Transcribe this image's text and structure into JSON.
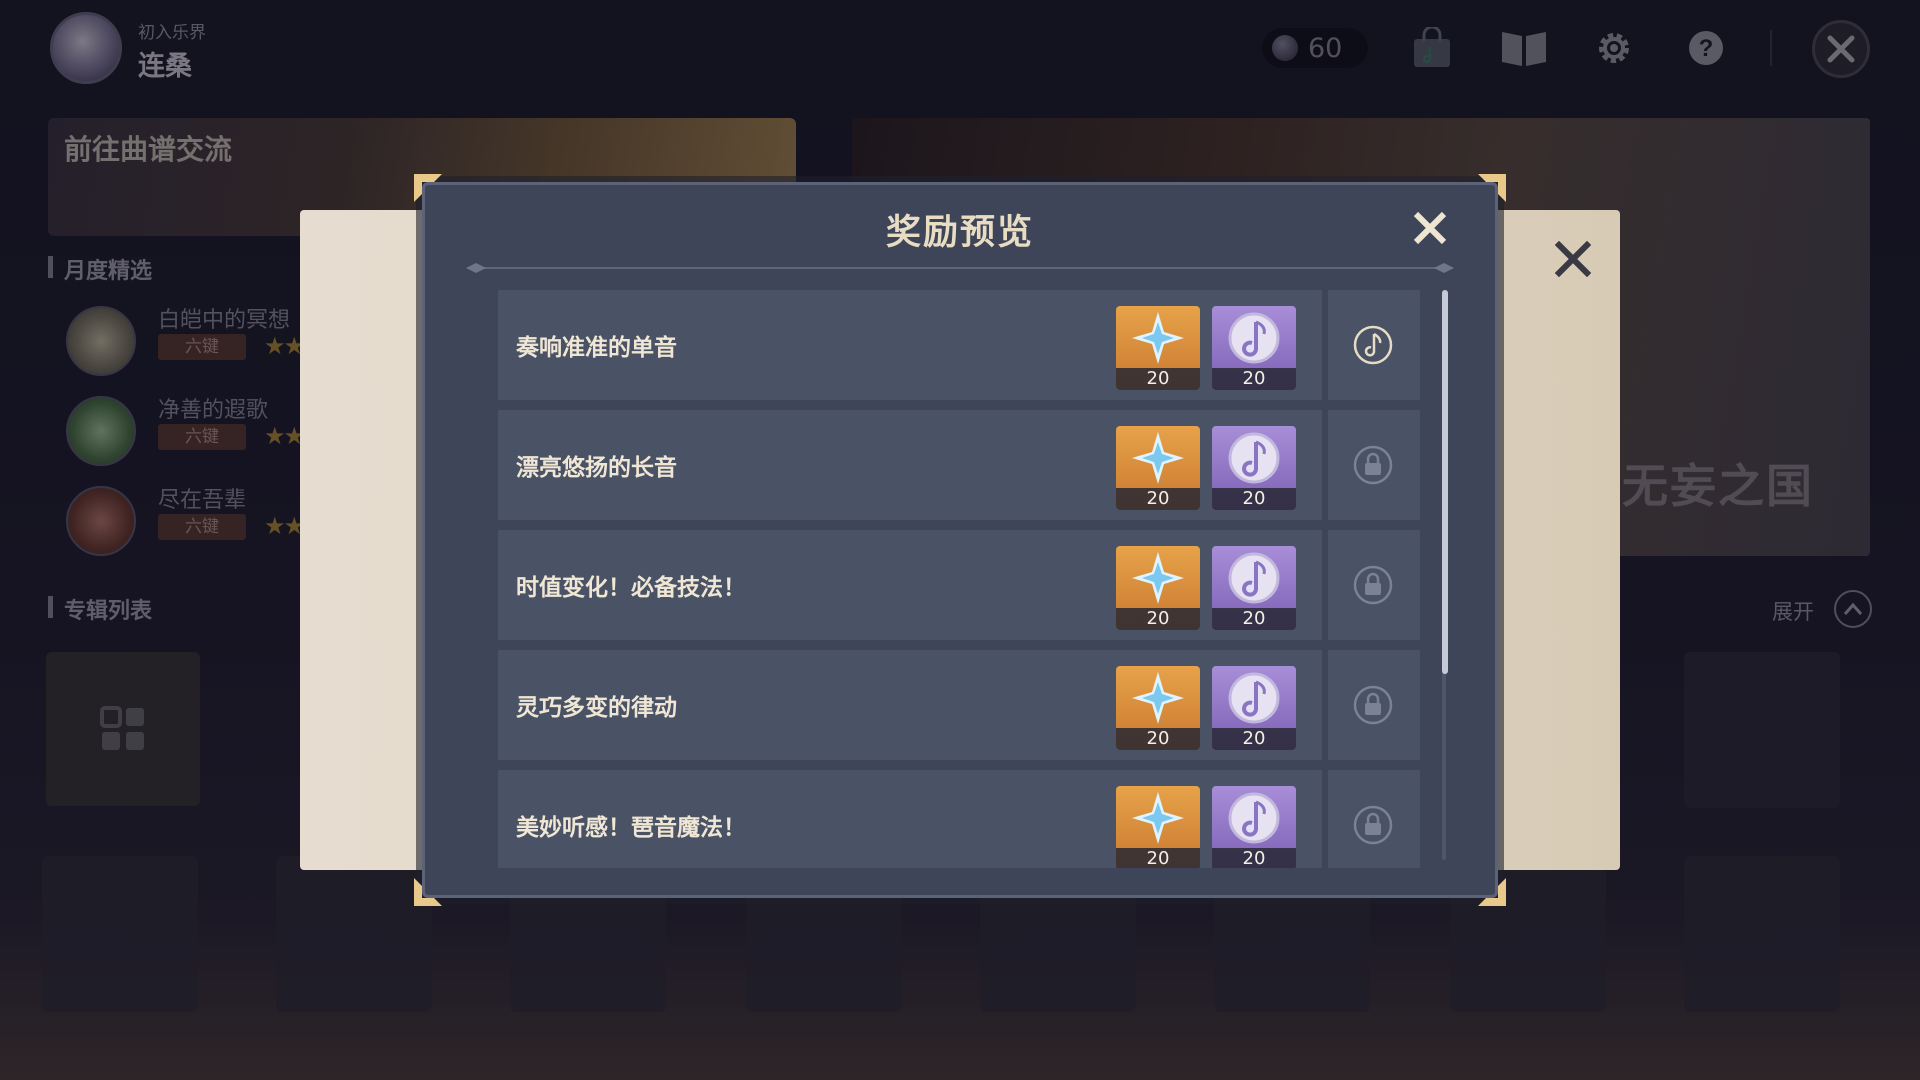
{
  "player": {
    "subtitle": "初入乐界",
    "name": "连桑"
  },
  "currency": {
    "value": "60",
    "icon": "music-coin-icon"
  },
  "top_icons": [
    "shop-bag-icon",
    "book-icon",
    "gear-icon",
    "help-icon",
    "exit-icon"
  ],
  "background": {
    "score_banner": "前往曲谱交流",
    "monthly_section": "月度精选",
    "album_section": "专辑列表",
    "expand_label": "展开",
    "feature_title": "无妄之国",
    "songs": [
      {
        "name": "白皑中的冥想",
        "tag": "六键",
        "stars": "★★"
      },
      {
        "name": "净善的遐歌",
        "tag": "六键",
        "stars": "★★"
      },
      {
        "name": "尽在吾辈",
        "tag": "六键",
        "stars": "★★"
      }
    ]
  },
  "dialog": {
    "title": "奖励预览",
    "colors": {
      "panel": "#3e4559",
      "row": "#4a5266",
      "gold_card": "#e7a24a",
      "purple_card": "#a88ed8",
      "title": "#e8dcc2"
    },
    "rewards": [
      {
        "name": "奏响准准的单音",
        "items": [
          {
            "icon": "primogem-star-icon",
            "count": "20"
          },
          {
            "icon": "music-note-token-icon",
            "count": "20"
          }
        ],
        "status": "claimable-note-icon"
      },
      {
        "name": "漂亮悠扬的长音",
        "items": [
          {
            "icon": "primogem-star-icon",
            "count": "20"
          },
          {
            "icon": "music-note-token-icon",
            "count": "20"
          }
        ],
        "status": "lock-icon"
      },
      {
        "name": "时值变化！必备技法！",
        "items": [
          {
            "icon": "primogem-star-icon",
            "count": "20"
          },
          {
            "icon": "music-note-token-icon",
            "count": "20"
          }
        ],
        "status": "lock-icon"
      },
      {
        "name": "灵巧多变的律动",
        "items": [
          {
            "icon": "primogem-star-icon",
            "count": "20"
          },
          {
            "icon": "music-note-token-icon",
            "count": "20"
          }
        ],
        "status": "lock-icon"
      },
      {
        "name": "美妙听感！琶音魔法！",
        "items": [
          {
            "icon": "primogem-star-icon",
            "count": "20"
          },
          {
            "icon": "music-note-token-icon",
            "count": "20"
          }
        ],
        "status": "lock-icon"
      }
    ]
  }
}
